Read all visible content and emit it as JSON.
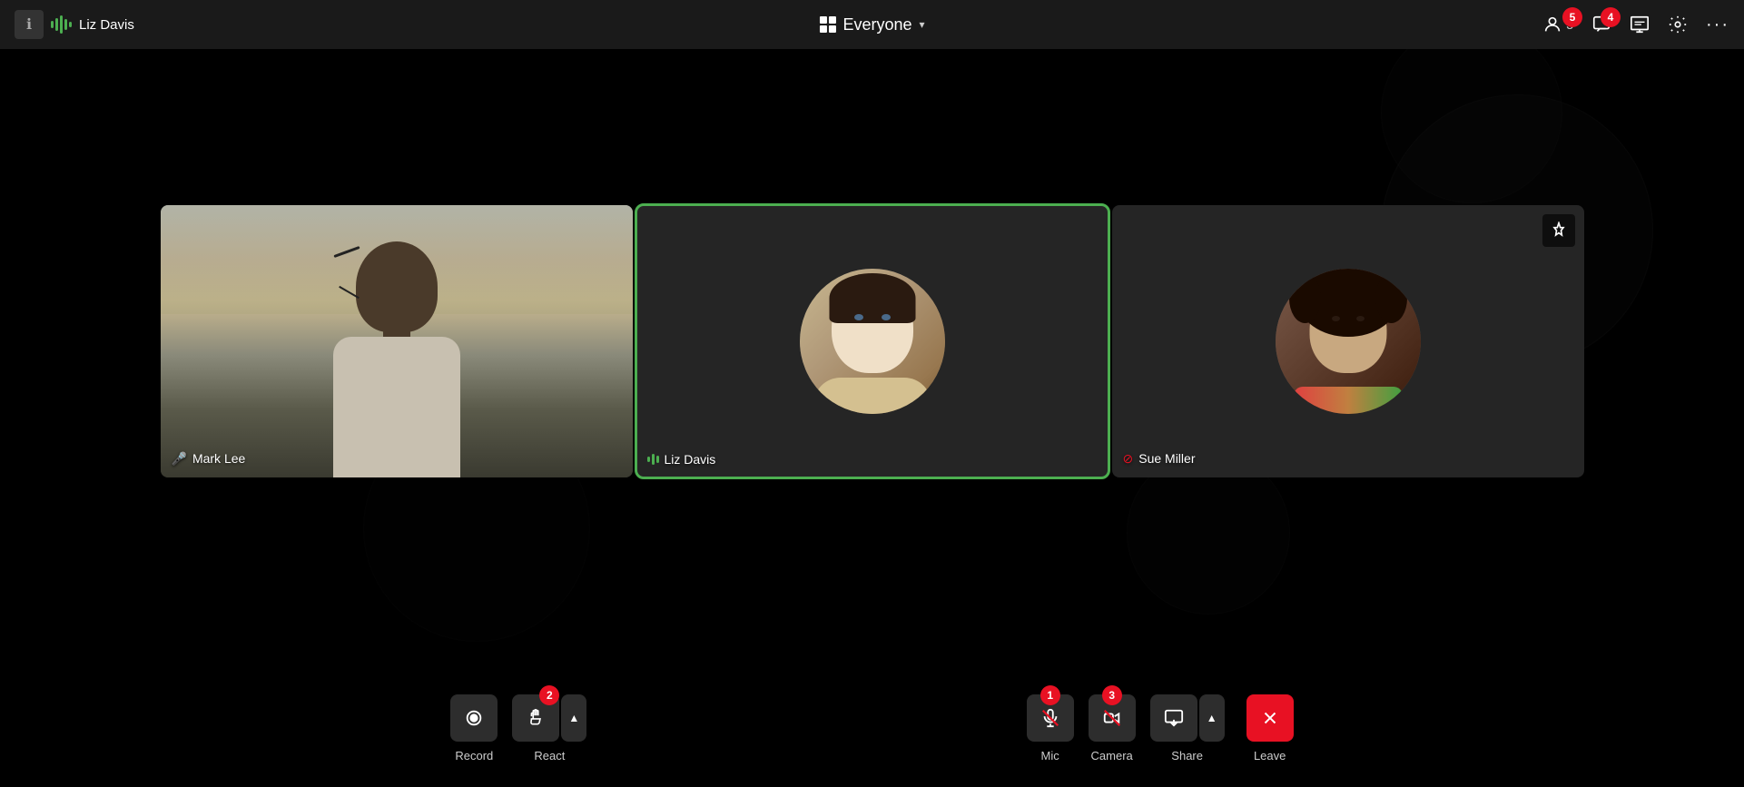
{
  "header": {
    "info_label": "i",
    "user_name": "Liz Davis",
    "everyone_label": "Everyone",
    "participants_count": "3",
    "badge_participants": "5",
    "badge_chat": "4"
  },
  "participants": [
    {
      "id": "mark-lee",
      "name": "Mark Lee",
      "muted": true,
      "active": false
    },
    {
      "id": "liz-davis",
      "name": "Liz Davis",
      "muted": false,
      "active": true
    },
    {
      "id": "sue-miller",
      "name": "Sue Miller",
      "muted": true,
      "active": false
    }
  ],
  "toolbar": {
    "record_label": "Record",
    "react_label": "React",
    "mic_label": "Mic",
    "camera_label": "Camera",
    "share_label": "Share",
    "leave_label": "Leave",
    "react_badge": "2",
    "mic_badge": "1",
    "camera_badge": "3"
  }
}
